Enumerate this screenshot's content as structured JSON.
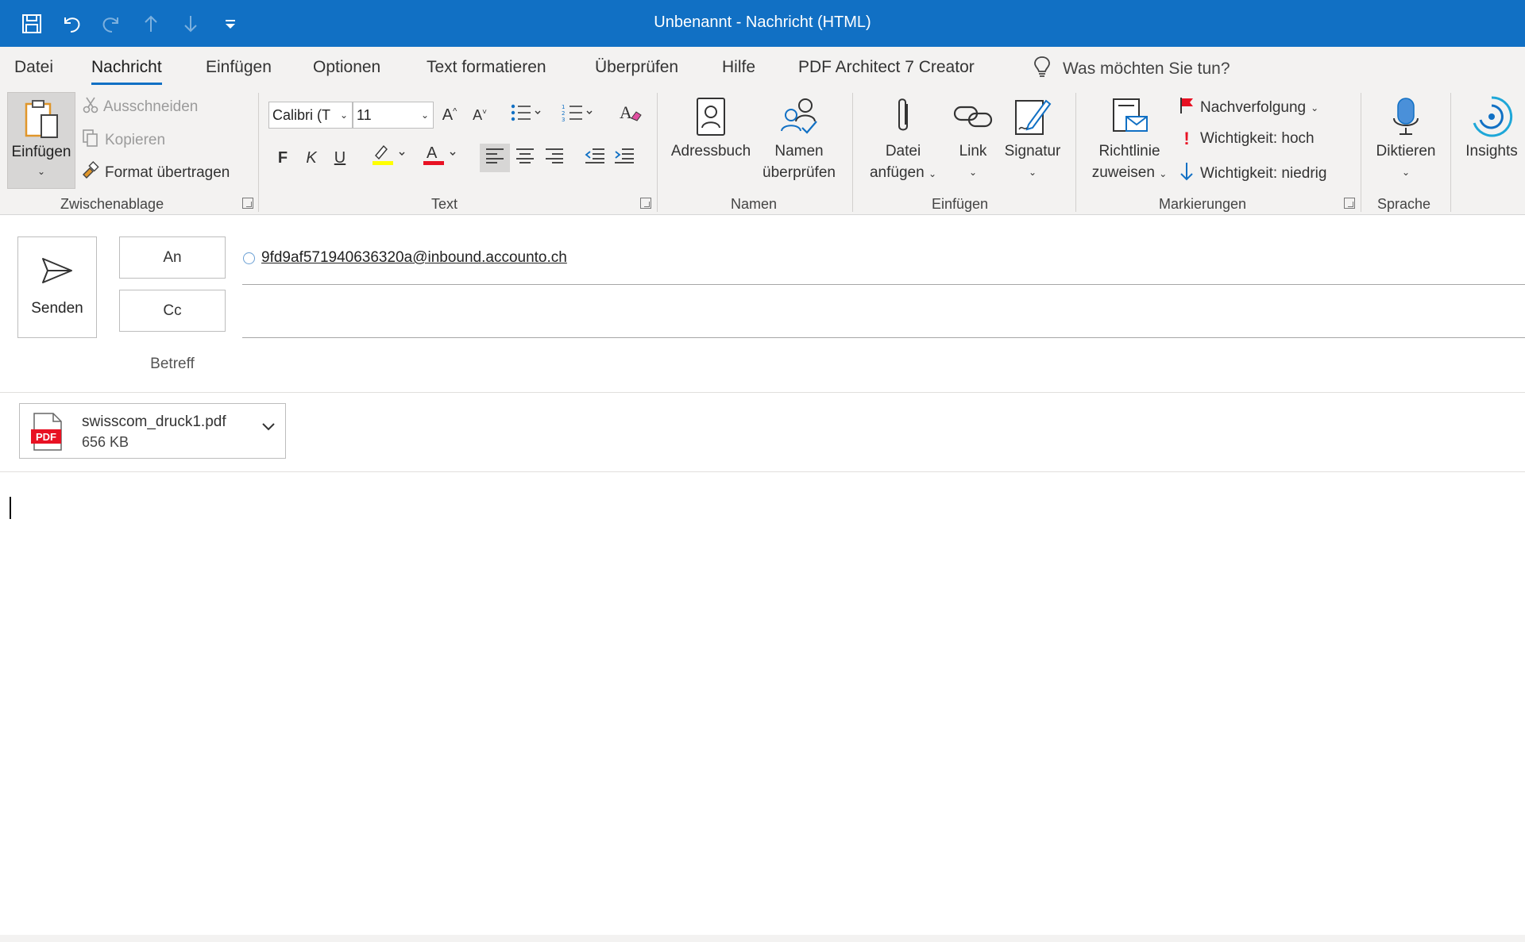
{
  "window": {
    "title": "Unbenannt  -  Nachricht (HTML)"
  },
  "quick_access": {
    "items": [
      {
        "name": "save-icon"
      },
      {
        "name": "undo-icon"
      },
      {
        "name": "redo-icon"
      },
      {
        "name": "arrow-up-icon"
      },
      {
        "name": "arrow-down-icon"
      },
      {
        "name": "customize-qat-icon"
      }
    ]
  },
  "menu": {
    "items": [
      "Datei",
      "Nachricht",
      "Einfügen",
      "Optionen",
      "Text formatieren",
      "Überprüfen",
      "Hilfe",
      "PDF Architect 7 Creator"
    ],
    "active": "Nachricht",
    "tell_me": "Was möchten Sie tun?"
  },
  "ribbon": {
    "clipboard": {
      "label": "Zwischenablage",
      "paste": "Einfügen",
      "cut": "Ausschneiden",
      "copy": "Kopieren",
      "format_painter": "Format übertragen"
    },
    "text": {
      "label": "Text",
      "font": "Calibri (T",
      "size": "11",
      "bold": "F",
      "italic": "K",
      "underline": "U",
      "highlight_color": "#ffff00",
      "font_color": "#e81123"
    },
    "names": {
      "label": "Namen",
      "address_book": "Adressbuch",
      "check_names_1": "Namen",
      "check_names_2": "überprüfen"
    },
    "insert": {
      "label": "Einfügen",
      "attach_1": "Datei",
      "attach_2": "anfügen",
      "link": "Link",
      "signature": "Signatur"
    },
    "tags": {
      "label": "Markierungen",
      "policy_1": "Richtlinie",
      "policy_2": "zuweisen",
      "follow_up": "Nachverfolgung",
      "importance_high": "Wichtigkeit: hoch",
      "importance_low": "Wichtigkeit: niedrig"
    },
    "voice": {
      "label": "Sprache",
      "dictate": "Diktieren"
    },
    "insights": "Insights"
  },
  "compose": {
    "send": "Senden",
    "to_button": "An",
    "cc_button": "Cc",
    "subject_label": "Betreff",
    "to_value": "9fd9af571940636320a@inbound.accounto.ch",
    "cc_value": "",
    "subject_value": "",
    "body": ""
  },
  "attachment": {
    "name": "swisscom_druck1.pdf",
    "size": "656 KB",
    "badge": "PDF"
  },
  "colors": {
    "accent": "#1170c4",
    "ribbon_bg": "#f3f2f1",
    "pdf_red": "#e81123",
    "flag_red": "#e81123"
  }
}
